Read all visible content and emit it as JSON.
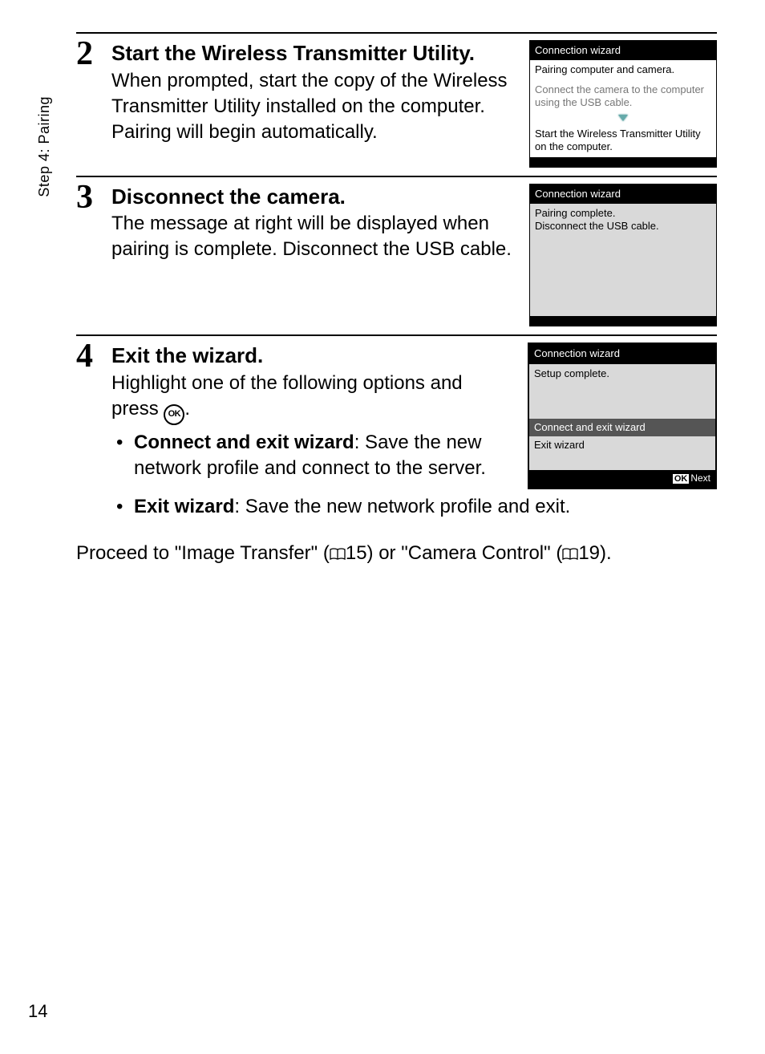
{
  "vertical_tab": "Step 4: Pairing",
  "page_number": "14",
  "steps": {
    "s2": {
      "num": "2",
      "title": "Start the Wireless Transmitter Utility.",
      "body": "When prompted, start the copy of the Wireless Transmitter Utility installed on the computer. Pairing will begin automatically."
    },
    "s3": {
      "num": "3",
      "title": "Disconnect the camera.",
      "body": "The message at right will be displayed when pairing is complete. Disconnect the USB cable."
    },
    "s4": {
      "num": "4",
      "title": "Exit the wizard.",
      "intro_a": "Highlight one of the following options and press ",
      "intro_b": ".",
      "bullets": [
        {
          "label": "Connect and exit wizard",
          "rest": ": Save the new network profile and connect to the server."
        },
        {
          "label": "Exit wizard",
          "rest": ": Save the new network profile and exit."
        }
      ]
    }
  },
  "proceed": {
    "a": "Proceed to \"Image Transfer\" (",
    "p1": "15",
    "b": ") or \"Camera Control\" (",
    "p2": "19",
    "c": ")."
  },
  "shots": {
    "s2": {
      "title": "Connection wizard",
      "line1": "Pairing computer and camera.",
      "line2": "Connect the camera to the computer using the USB cable.",
      "line3": "Start the Wireless Transmitter Utility on the computer."
    },
    "s3": {
      "title": "Connection wizard",
      "line1": "Pairing complete.",
      "line2": "Disconnect the USB cable."
    },
    "s4": {
      "title": "Connection wizard",
      "line1": "Setup complete.",
      "opt1": "Connect and exit wizard",
      "opt2": "Exit wizard",
      "ok": "OK",
      "next": "Next"
    }
  },
  "ok_glyph": "OK"
}
